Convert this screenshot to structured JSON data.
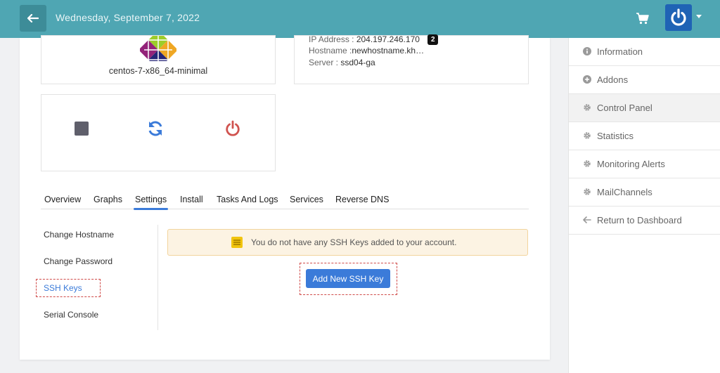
{
  "header": {
    "date": "Wednesday, September 7, 2022",
    "back_icon": "arrow-left-icon",
    "cart_icon": "cart-icon",
    "power_icon": "power-icon",
    "accent_color": "#4fa6b3"
  },
  "server": {
    "os_name": "centos-7-x86_64-minimal",
    "ip_label": "IP Address :",
    "ip_value": "204.197.246.170",
    "ip_badge": "2",
    "hostname_label": "Hostname :",
    "hostname_value": "newhostname.kh…",
    "server_label": "Server :",
    "server_value": "ssd04-ga"
  },
  "controls": {
    "stop_icon": "stop-icon",
    "restart_icon": "restart-icon",
    "power_icon": "power-icon"
  },
  "tabs": [
    {
      "label": "Overview"
    },
    {
      "label": "Graphs"
    },
    {
      "label": "Settings",
      "active": true
    },
    {
      "label": "Install"
    },
    {
      "label": "Tasks And Logs"
    },
    {
      "label": "Services"
    },
    {
      "label": "Reverse DNS"
    }
  ],
  "settings_nav": [
    {
      "label": "Change Hostname"
    },
    {
      "label": "Change Password"
    },
    {
      "label": "SSH Keys",
      "active": true
    },
    {
      "label": "Serial Console"
    }
  ],
  "ssh": {
    "alert_text": "You do not have any SSH Keys added to your account.",
    "add_button": "Add New SSH Key"
  },
  "sidebar": {
    "items": [
      {
        "label": "Information",
        "icon": "info-icon"
      },
      {
        "label": "Addons",
        "icon": "plus-circle-icon"
      },
      {
        "label": "Control Panel",
        "icon": "gear-icon",
        "active": true
      },
      {
        "label": "Statistics",
        "icon": "gear-icon"
      },
      {
        "label": "Monitoring Alerts",
        "icon": "gear-icon"
      },
      {
        "label": "MailChannels",
        "icon": "gear-icon"
      },
      {
        "label": "Return to Dashboard",
        "icon": "arrow-left-icon"
      }
    ]
  }
}
